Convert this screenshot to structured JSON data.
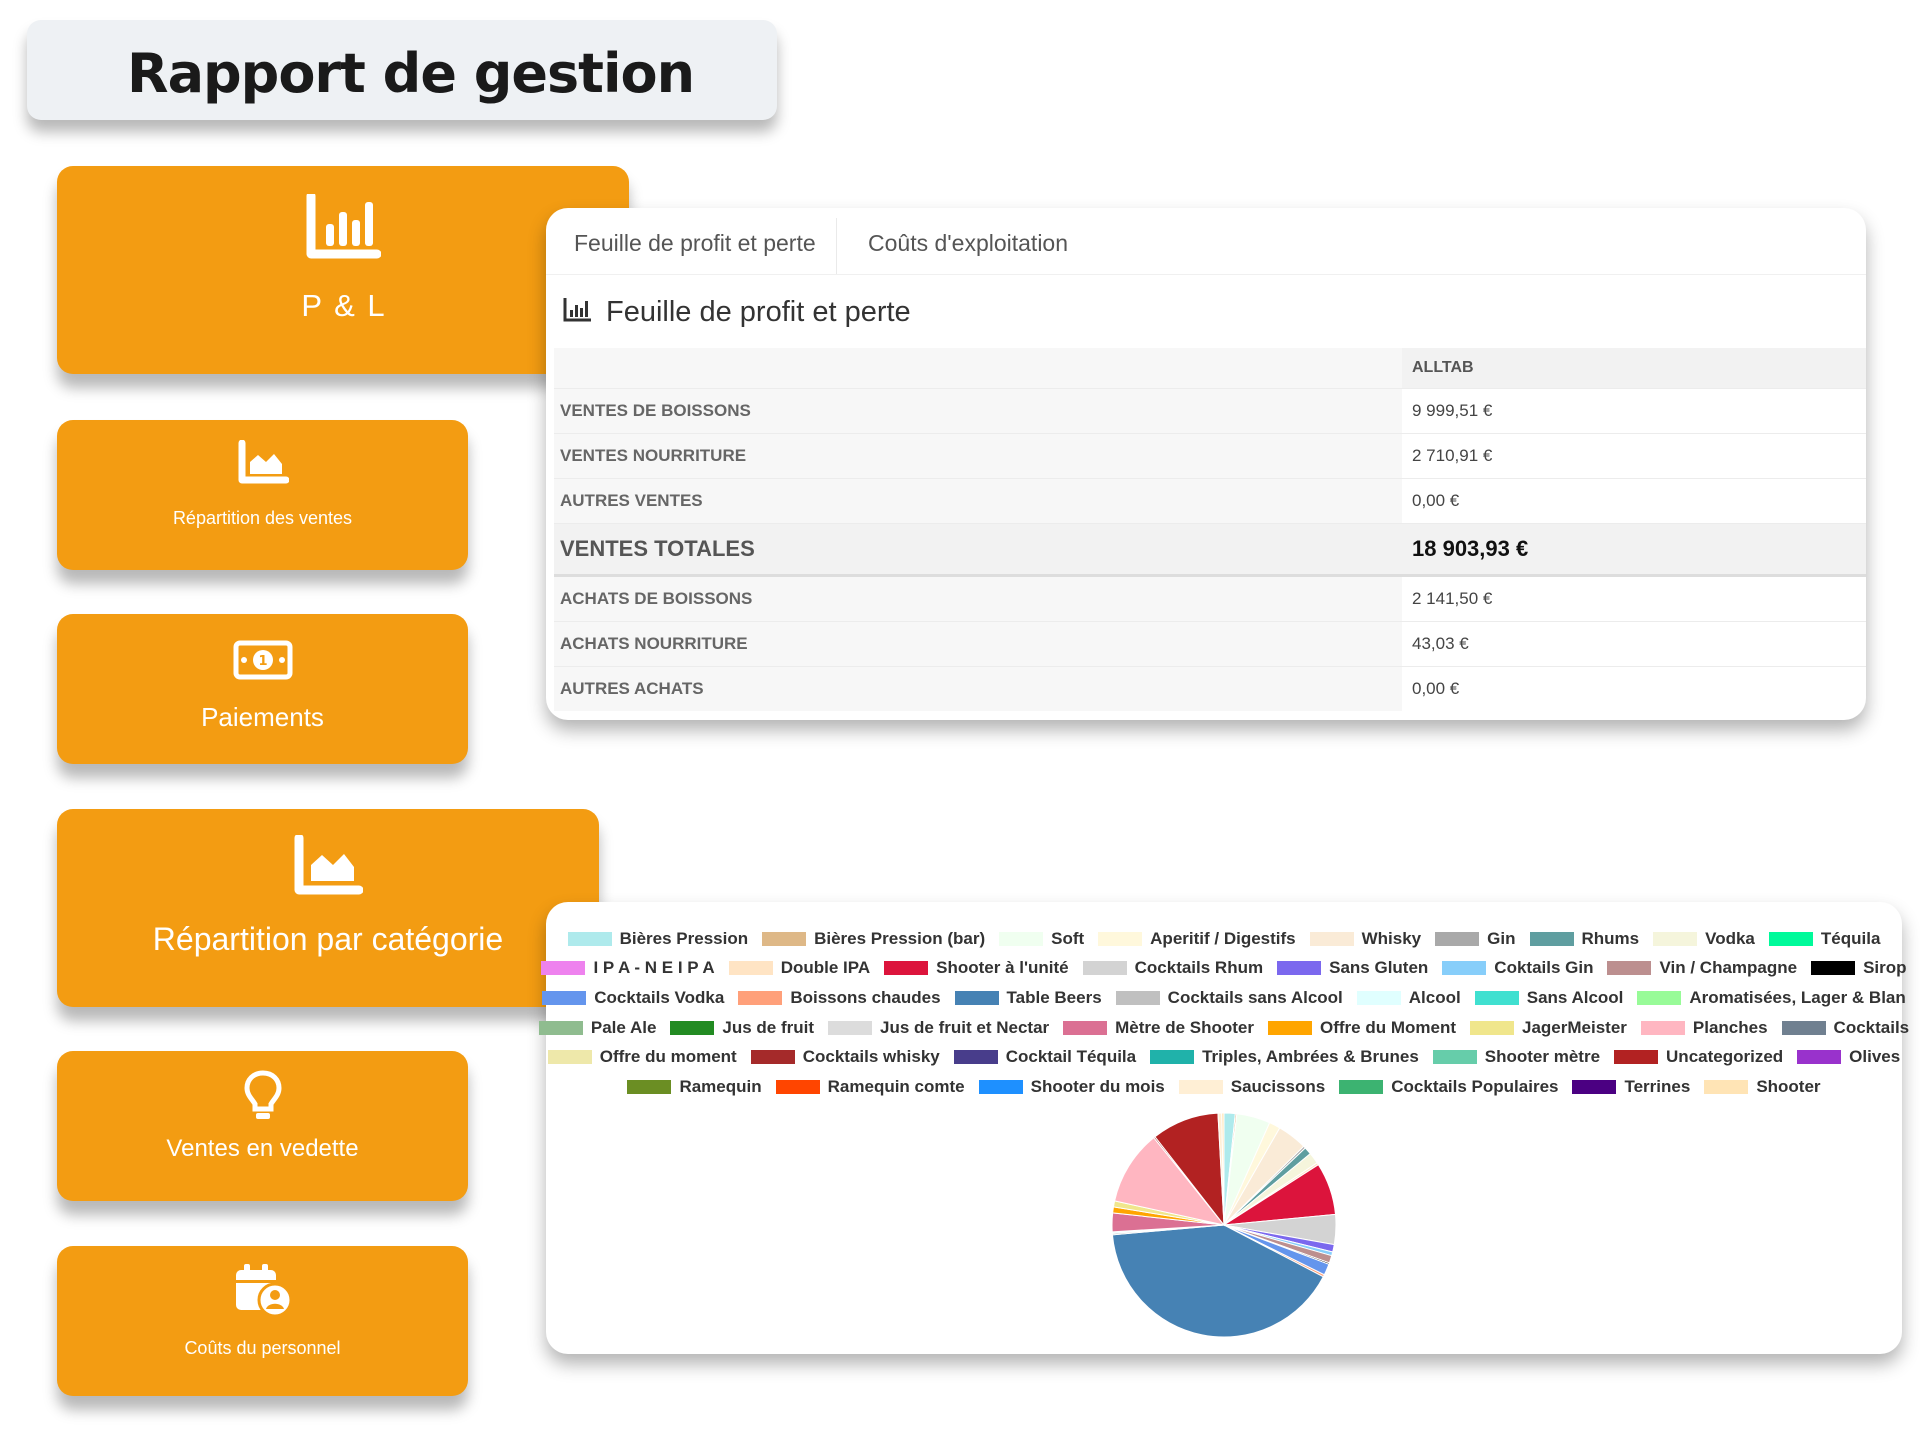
{
  "page_title": "Rapport de gestion",
  "cards": [
    {
      "label": "P & L",
      "icon": "bar-chart-icon"
    },
    {
      "label": "Répartition des ventes",
      "icon": "area-chart-icon"
    },
    {
      "label": "Paiements",
      "icon": "money-icon"
    },
    {
      "label": "Répartition par catégorie",
      "icon": "area-chart-icon"
    },
    {
      "label": "Ventes en vedette",
      "icon": "lightbulb-icon"
    },
    {
      "label": "Coûts du personnel",
      "icon": "calendar-user-icon"
    }
  ],
  "pl_panel": {
    "tabs": [
      "Feuille de profit et perte",
      "Coûts d'exploitation"
    ],
    "title": "Feuille de profit et perte",
    "column_header": "ALLTAB",
    "rows": [
      {
        "label": "VENTES DE BOISSONS",
        "value": "9 999,51 €"
      },
      {
        "label": "VENTES NOURRITURE",
        "value": "2 710,91 €"
      },
      {
        "label": "AUTRES VENTES",
        "value": "0,00 €"
      },
      {
        "label": "VENTES TOTALES",
        "value": "18 903,93 €"
      },
      {
        "label": "ACHATS DE BOISSONS",
        "value": "2 141,50 €"
      },
      {
        "label": "ACHATS NOURRITURE",
        "value": "43,03 €"
      },
      {
        "label": "AUTRES ACHATS",
        "value": "0,00 €"
      }
    ]
  },
  "chart_data": {
    "type": "pie",
    "title": "",
    "legend_placement": "top",
    "categories": [
      "Bières Pression",
      "Bières Pression (bar)",
      "Soft",
      "Aperitif / Digestifs",
      "Whisky",
      "Gin",
      "Rhums",
      "Vodka",
      "Téquila",
      "I P A - N E I P A",
      "Double IPA",
      "Shooter à l'unité",
      "Cocktails Rhum",
      "Sans Gluten",
      "Coktails Gin",
      "Vin / Champagne",
      "Sirop",
      "Cocktails Vodka",
      "Boissons chaudes",
      "Table Beers",
      "Cocktails sans Alcool",
      "Alcool",
      "Sans Alcool",
      "Aromatisées, Lager & Blan",
      "Pale Ale",
      "Jus de fruit",
      "Jus de fruit et Nectar",
      "Mètre de Shooter",
      "Offre du Moment",
      "JagerMeister",
      "Planches",
      "Cocktails",
      "Offre du moment",
      "Cocktails whisky",
      "Cocktail Téquila",
      "Triples, Ambrées & Brunes",
      "Shooter mètre",
      "Uncategorized",
      "Olives",
      "Ramequin",
      "Ramequin comte",
      "Shooter du mois",
      "Saucissons",
      "Cocktails Populaires",
      "Terrines",
      "Shooter"
    ],
    "colors": [
      "#aeeaec",
      "#deb887",
      "#f0fff0",
      "#fff8dc",
      "#faebd7",
      "#a9a9a9",
      "#5f9ea0",
      "#f5f5dc",
      "#00fa9a",
      "#ee82ee",
      "#ffe4c4",
      "#dc143c",
      "#d3d3d3",
      "#7b68ee",
      "#87cefa",
      "#bc8f8f",
      "#000000",
      "#6495ed",
      "#ffa07a",
      "#4682b4",
      "#c0c0c0",
      "#e0ffff",
      "#40e0d0",
      "#98fb98",
      "#8fbc8f",
      "#228b22",
      "#dcdcdc",
      "#db7093",
      "#ffa500",
      "#f0e68c",
      "#ffb6c1",
      "#708090",
      "#eee8aa",
      "#a52a2a",
      "#483d8b",
      "#20b2aa",
      "#66cdaa",
      "#b22222",
      "#9932cc",
      "#6b8e23",
      "#ff4500",
      "#1e90ff",
      "#ffefd5",
      "#3cb371",
      "#4b0082",
      "#ffe4b5"
    ],
    "values": [
      1.5,
      0.2,
      4.5,
      1.5,
      4,
      0.3,
      1,
      1.5,
      0,
      0,
      0.3,
      7,
      4,
      1,
      0.5,
      1,
      0.2,
      1.5,
      0.3,
      38,
      0.2,
      0.2,
      0,
      0,
      0,
      0,
      0,
      2.5,
      0.8,
      0.8,
      10,
      0,
      0,
      0.2,
      0,
      0,
      0,
      9,
      0,
      0,
      0,
      0,
      0.5,
      0,
      0,
      0.3
    ]
  }
}
